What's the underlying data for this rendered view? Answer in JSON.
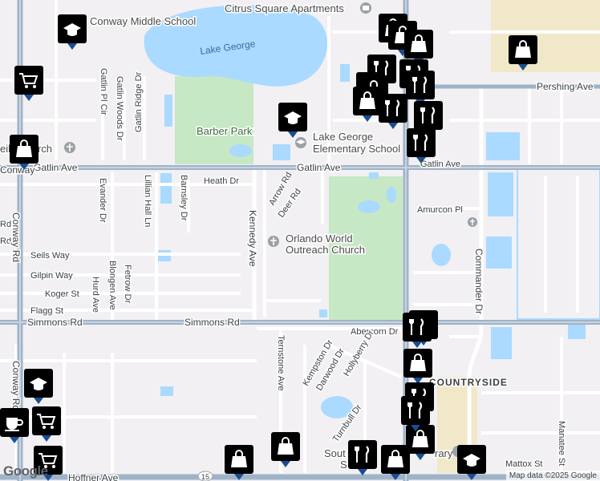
{
  "map": {
    "roads": {
      "conway_rd": "Conway Rd",
      "conway_rd_short": "Rd",
      "gatlin_ave": "Gatlin Ave",
      "heath_dr": "Heath Dr",
      "pershing_ave": "Pershing Ave",
      "simmons_rd": "Simmons Rd",
      "kennedy_ave": "Kennedy Ave",
      "commander_dr": "Commander Dr",
      "amurcon_pl": "Amurcon Pl",
      "abercorn_dr": "Abercorn Dr",
      "arrow_rd": "Arrow Rd",
      "deer_rd": "Deer Rd",
      "barnsley_dr": "Barnsley Dr",
      "lillian_hall_ln": "Lillian Hall Ln",
      "evander_dr": "Evander Dr",
      "gatlin_pl_cir": "Gatlin Pl Cir",
      "gatlin_woods_dr": "Gatlin Woods Dr",
      "gatlin_ridge_dr": "Gatlin Ridge Dr",
      "seils_way": "Seils Way",
      "gilpin_way": "Gilpin Way",
      "koger_st": "Koger St",
      "flagg_st": "Flagg St",
      "hurd_ave": "Hurd Ave",
      "blongen_ave": "Blongen Ave",
      "fetrow_dr": "Fetrow Dr",
      "ternstone_ave": "Ternstone Ave",
      "kempston_dr": "Kempston Dr",
      "darwood_dr": "Darwood Dr",
      "hollyberry_dr": "Hollyberry Dr",
      "turnbull_dr": "Turnbull Dr",
      "mattox_st": "Mattox St",
      "manatee_st": "Manatee St",
      "hoffner_ave": "Hoffner Ave",
      "route_15": "15"
    },
    "places": {
      "citrus_square": "Citrus Square Apartments",
      "conway_middle": "Conway Middle School",
      "lake_george": "Lake George",
      "barber_park": "Barber Park",
      "lake_george_elem_1": "Lake George",
      "lake_george_elem_2": "Elementary School",
      "orlando_world_1": "Orlando World",
      "orlando_world_2": "Outreach Church",
      "church_left": "eils Church",
      "conway_area": "Conway",
      "countryside": "COUNTRYSIDE",
      "south_partial": "Sout",
      "library_partial": "rary",
      "s_partial": "S"
    },
    "attribution": "Map data ©2025 Google",
    "logo": "Google",
    "colors": {
      "road_major": "#9fb3c8",
      "road_minor": "#ffffff",
      "park": "#c6e8c4",
      "water": "#aadaff",
      "pin": "#1a4d8f",
      "yellow_zone": "#f0e8c8"
    }
  }
}
